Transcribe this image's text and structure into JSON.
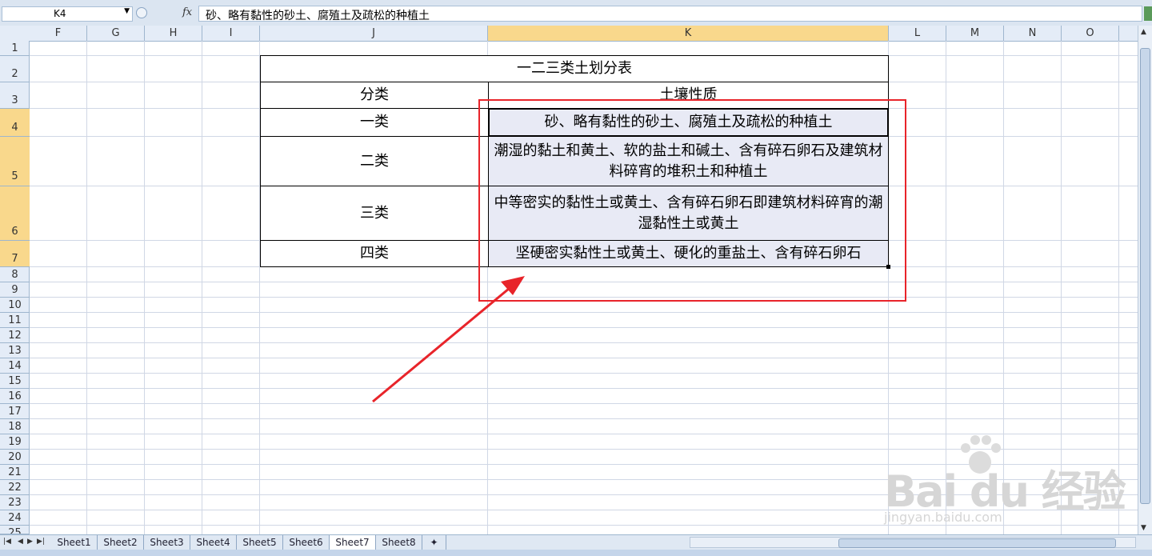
{
  "formula_bar": {
    "name_box": "K4",
    "fx": "fx",
    "content": "砂、略有黏性的砂土、腐殖土及疏松的种植土"
  },
  "columns": [
    "F",
    "G",
    "H",
    "I",
    "J",
    "K",
    "L",
    "M",
    "N",
    "O"
  ],
  "selected_column": "K",
  "rows": [
    "1",
    "2",
    "3",
    "4",
    "5",
    "6",
    "7",
    "8",
    "9",
    "10",
    "11",
    "12",
    "13",
    "14",
    "15",
    "16",
    "17",
    "18",
    "19",
    "20",
    "21",
    "22",
    "23",
    "24",
    "25"
  ],
  "table": {
    "title": "一二三类土划分表",
    "header_category": "分类",
    "header_property": "土壤性质",
    "rows": [
      {
        "category": "一类",
        "property": "砂、略有黏性的砂土、腐殖土及疏松的种植土"
      },
      {
        "category": "二类",
        "property": "潮湿的黏土和黄土、软的盐土和碱土、含有碎石卵石及建筑材料碎宵的堆积土和种植土"
      },
      {
        "category": "三类",
        "property": "中等密实的黏性土或黄土、含有碎石卵石即建筑材料碎宵的潮湿黏性土或黄土"
      },
      {
        "category": "四类",
        "property": "坚硬密实黏性土或黄土、硬化的重盐土、含有碎石卵石"
      }
    ]
  },
  "sheet_tabs": [
    "Sheet1",
    "Sheet2",
    "Sheet3",
    "Sheet4",
    "Sheet5",
    "Sheet6",
    "Sheet7",
    "Sheet8"
  ],
  "active_sheet": "Sheet7",
  "watermark": {
    "brand": "Bai du 经验",
    "url": "jingyan.baidu.com"
  },
  "colors": {
    "selection_header": "#f9d88c",
    "highlight_box": "#e8242a",
    "cell_fill": "#e8eaf5"
  }
}
